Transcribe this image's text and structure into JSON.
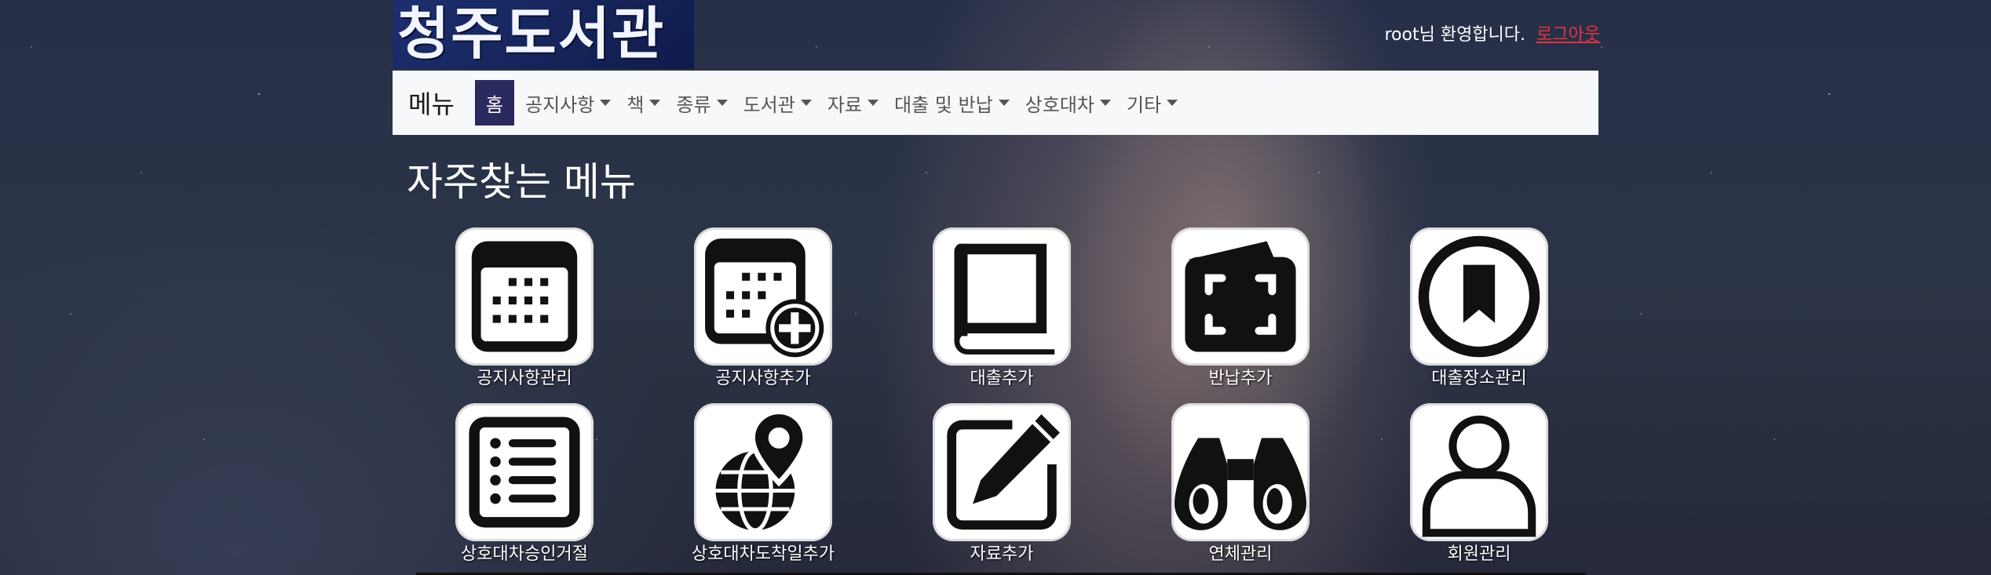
{
  "header": {
    "logo_text": "청주도서관",
    "welcome_text": "root님 환영합니다.",
    "logout_label": "로그아웃"
  },
  "navbar": {
    "brand": "메뉴",
    "items": [
      {
        "label": "홈",
        "active": true,
        "dropdown": false
      },
      {
        "label": "공지사항",
        "dropdown": true
      },
      {
        "label": "책",
        "dropdown": true
      },
      {
        "label": "종류",
        "dropdown": true
      },
      {
        "label": "도서관",
        "dropdown": true
      },
      {
        "label": "자료",
        "dropdown": true
      },
      {
        "label": "대출 및 반납",
        "dropdown": true
      },
      {
        "label": "상호대차",
        "dropdown": true
      },
      {
        "label": "기타",
        "dropdown": true
      }
    ]
  },
  "quick_menu": {
    "title": "자주찾는 메뉴",
    "tiles": [
      {
        "label": "공지사항관리",
        "icon": "calendar-icon"
      },
      {
        "label": "공지사항추가",
        "icon": "calendar-add-icon"
      },
      {
        "label": "대출추가",
        "icon": "book-icon"
      },
      {
        "label": "반납추가",
        "icon": "wallet-scan-icon"
      },
      {
        "label": "대출장소관리",
        "icon": "bookmark-circle-icon"
      },
      {
        "label": "상호대차승인거절",
        "icon": "list-icon"
      },
      {
        "label": "상호대차도착일추가",
        "icon": "globe-pin-icon"
      },
      {
        "label": "자료추가",
        "icon": "edit-icon"
      },
      {
        "label": "연체관리",
        "icon": "binoculars-icon"
      },
      {
        "label": "회원관리",
        "icon": "user-icon"
      }
    ]
  },
  "colors": {
    "nav_active_bg": "#2b2a5e",
    "logout_color": "#e3353d"
  }
}
